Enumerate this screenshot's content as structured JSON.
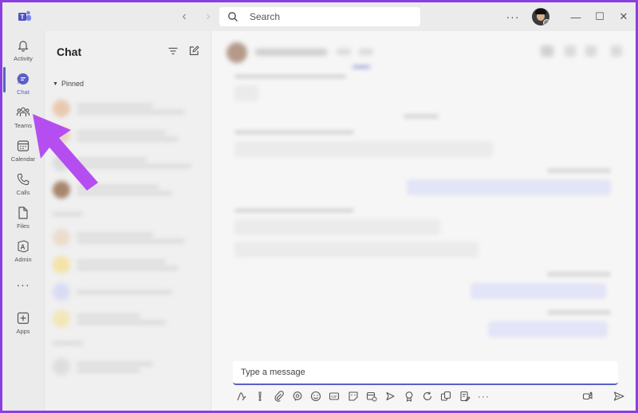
{
  "colors": {
    "accent": "#5b5fc7",
    "arrow": "#b54ef0",
    "frame": "#8b3fe0"
  },
  "search": {
    "placeholder": "Search"
  },
  "rail": {
    "items": [
      {
        "label": "Activity",
        "icon": "bell-icon"
      },
      {
        "label": "Chat",
        "icon": "chat-bubble-icon",
        "active": true
      },
      {
        "label": "Teams",
        "icon": "teams-icon"
      },
      {
        "label": "Calendar",
        "icon": "calendar-icon"
      },
      {
        "label": "Calls",
        "icon": "phone-icon"
      },
      {
        "label": "Files",
        "icon": "file-icon"
      },
      {
        "label": "Admin",
        "icon": "admin-icon"
      },
      {
        "label": "Apps",
        "icon": "apps-plus-icon"
      }
    ],
    "more": "···"
  },
  "chat_panel": {
    "title": "Chat",
    "pinned_label": "Pinned"
  },
  "composer": {
    "placeholder": "Type a message"
  },
  "titlebar": {
    "more": "···"
  }
}
